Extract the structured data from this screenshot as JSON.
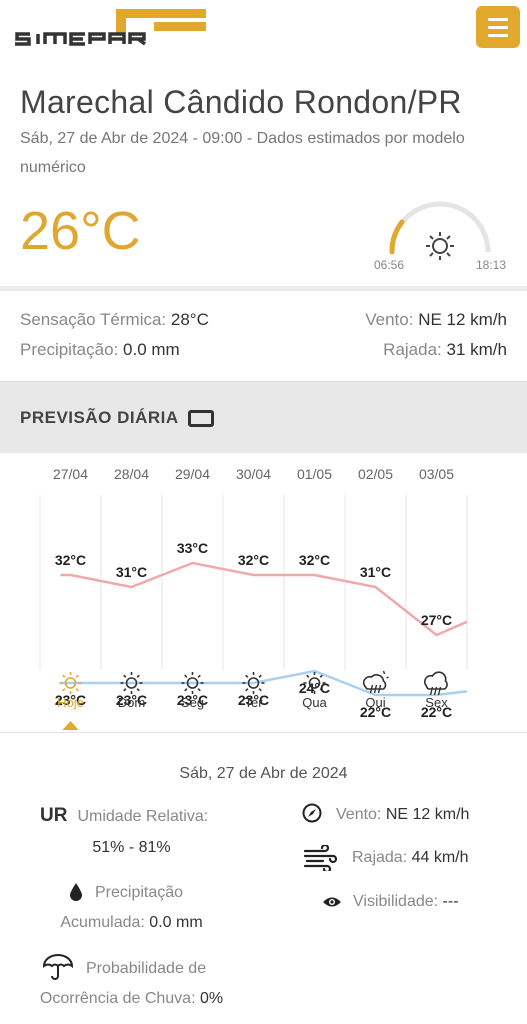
{
  "header": {
    "brand": "SIMEPAR",
    "menu_icon": "hamburger-menu-icon",
    "accent_color": "#e2a82c"
  },
  "location": {
    "city": "Marechal Cândido Rondon/PR",
    "subtitle": "Sáb, 27 de Abr de 2024 - 09:00 - Dados estimados por modelo numérico"
  },
  "current": {
    "temperature": "26°C",
    "sunrise": "06:56",
    "sunset": "18:13",
    "sun_icon": "sun-icon",
    "sensacao_label": "Sensação Térmica:",
    "sensacao_value": "28°C",
    "precipitacao_label": "Precipitação:",
    "precipitacao_value": "0.0 mm",
    "vento_label": "Vento:",
    "vento_value": "NE 12 km/h",
    "rajada_label": "Rajada:",
    "rajada_value": "31 km/h"
  },
  "forecast": {
    "title": "PREVISÃO DIÁRIA",
    "toggle_icon": "table-view-icon"
  },
  "chart_data": {
    "type": "line",
    "categories": [
      "27/04",
      "28/04",
      "29/04",
      "30/04",
      "01/05",
      "02/05",
      "03/05"
    ],
    "days": [
      "Hoje",
      "Dom",
      "Seg",
      "Ter",
      "Qua",
      "Qui",
      "Sex"
    ],
    "icons": [
      "sun-icon",
      "sun-icon",
      "sun-icon",
      "sun-icon",
      "sun-icon",
      "sun-rain-icon",
      "cloud-rain-icon"
    ],
    "selected_index": 0,
    "series": [
      {
        "name": "max",
        "color": "#f0a8a8",
        "values": [
          32,
          31,
          33,
          32,
          32,
          31,
          27
        ]
      },
      {
        "name": "min",
        "color": "#a8d0f0",
        "values": [
          23,
          23,
          23,
          23,
          24,
          22,
          22
        ]
      }
    ],
    "unit": "°C"
  },
  "detail": {
    "date": "Sáb, 27 de Abr de 2024",
    "ur_abbr": "UR",
    "ur_label": "Umidade Relativa:",
    "ur_value": "51% - 81%",
    "prec_line1": "Precipitação",
    "prec_label": "Acumulada:",
    "prec_value": "0.0 mm",
    "prob_line1": "Probabilidade de",
    "prob_label": "Ocorrência de Chuva:",
    "prob_value": "0%",
    "vento_label": "Vento:",
    "vento_value": "NE 12 km/h",
    "rajada_label": "Rajada:",
    "rajada_value": "44 km/h",
    "vis_label": "Visibilidade:",
    "vis_value": "---"
  }
}
